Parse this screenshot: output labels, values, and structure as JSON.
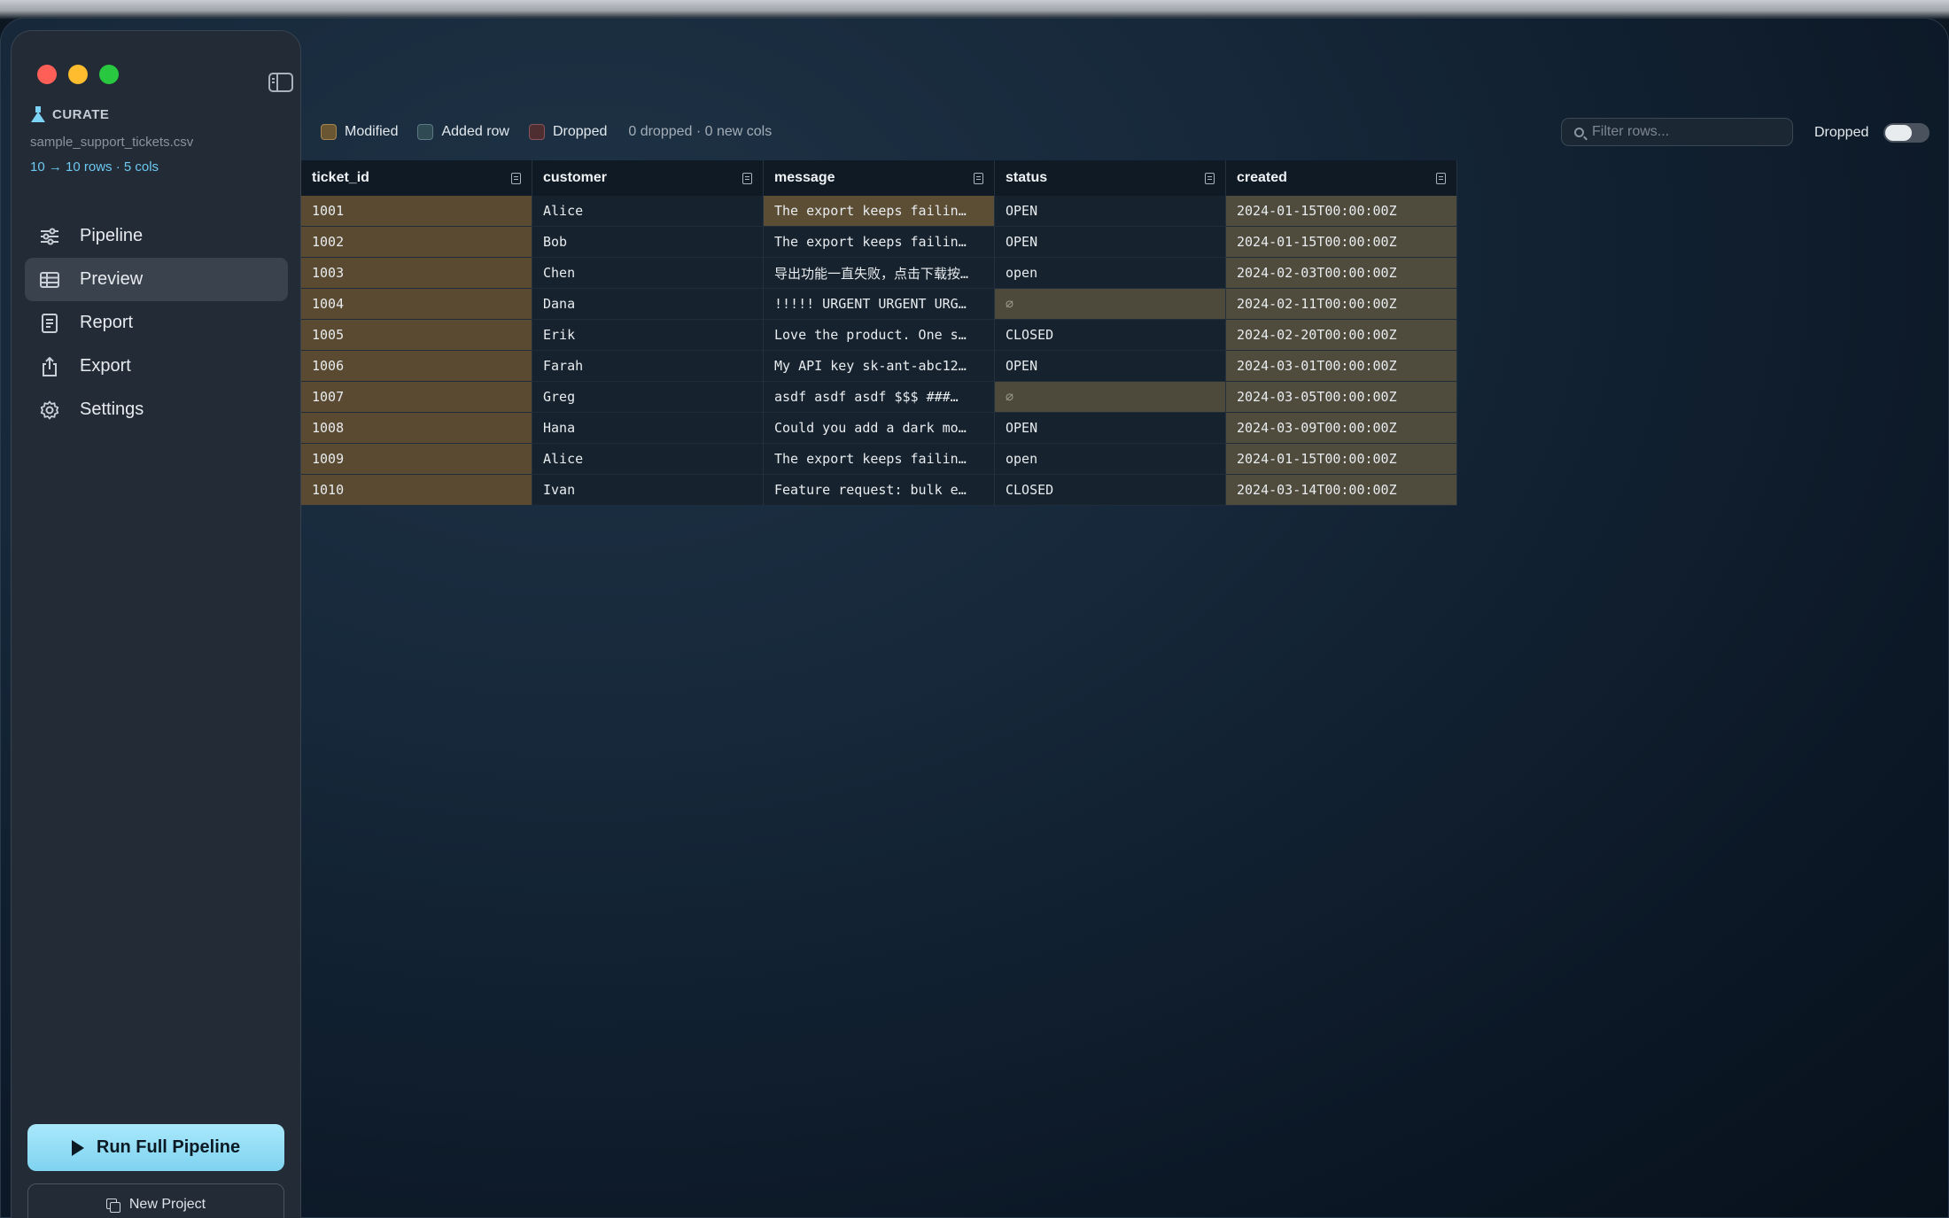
{
  "app": {
    "name": "CURATE",
    "filename": "sample_support_tickets.csv",
    "row_info": "10 → 10 rows · 5 cols"
  },
  "nav": [
    {
      "label": "Pipeline",
      "icon": "sliders-icon",
      "active": false
    },
    {
      "label": "Preview",
      "icon": "table-icon",
      "active": true
    },
    {
      "label": "Report",
      "icon": "report-icon",
      "active": false
    },
    {
      "label": "Export",
      "icon": "export-icon",
      "active": false
    },
    {
      "label": "Settings",
      "icon": "gear-icon",
      "active": false
    }
  ],
  "actions": {
    "run_label": "Run Full Pipeline",
    "new_label": "New Project"
  },
  "legend": {
    "modified": "Modified",
    "added": "Added row",
    "dropped": "Dropped",
    "summary": "0 dropped · 0 new cols"
  },
  "filter": {
    "placeholder": "Filter rows..."
  },
  "toggle": {
    "label": "Dropped",
    "on": false
  },
  "table": {
    "columns": [
      "ticket_id",
      "customer",
      "message",
      "status",
      "created"
    ],
    "rows": [
      [
        "1001",
        "Alice",
        "The export keeps failin…",
        "OPEN",
        "2024-01-15T00:00:00Z"
      ],
      [
        "1002",
        "Bob",
        "The export keeps failin…",
        "OPEN",
        "2024-01-15T00:00:00Z"
      ],
      [
        "1003",
        "Chen",
        "导出功能一直失败，点击下载按…",
        "open",
        "2024-02-03T00:00:00Z"
      ],
      [
        "1004",
        "Dana",
        "!!!!! URGENT URGENT URG…",
        "∅",
        "2024-02-11T00:00:00Z"
      ],
      [
        "1005",
        "Erik",
        "Love the product. One s…",
        "CLOSED",
        "2024-02-20T00:00:00Z"
      ],
      [
        "1006",
        "Farah",
        "My API key sk-ant-abc12…",
        "OPEN",
        "2024-03-01T00:00:00Z"
      ],
      [
        "1007",
        "Greg",
        "asdf asdf asdf $$$ ###…",
        "∅",
        "2024-03-05T00:00:00Z"
      ],
      [
        "1008",
        "Hana",
        "Could you add a dark mo…",
        "OPEN",
        "2024-03-09T00:00:00Z"
      ],
      [
        "1009",
        "Alice",
        "The export keeps failin…",
        "open",
        "2024-01-15T00:00:00Z"
      ],
      [
        "1010",
        "Ivan",
        "Feature request: bulk e…",
        "CLOSED",
        "2024-03-14T00:00:00Z"
      ]
    ],
    "modified_message_rows": [
      0
    ],
    "null_status_rows": [
      3,
      6
    ]
  },
  "colors": {
    "accent": "#7fd3f0",
    "modified": "#5a4a31",
    "window_bg": "#16283a"
  }
}
